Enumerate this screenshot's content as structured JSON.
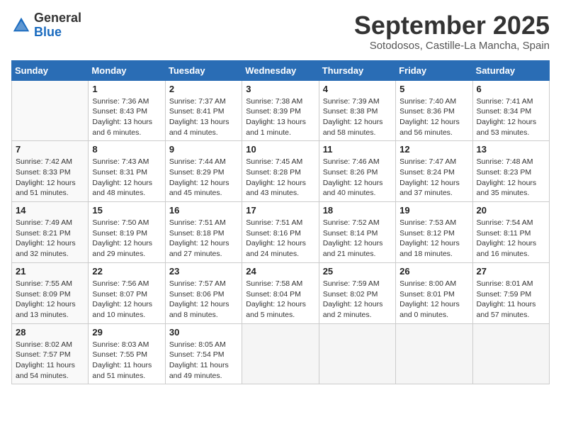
{
  "logo": {
    "general": "General",
    "blue": "Blue"
  },
  "title": "September 2025",
  "subtitle": "Sotodosos, Castille-La Mancha, Spain",
  "days_of_week": [
    "Sunday",
    "Monday",
    "Tuesday",
    "Wednesday",
    "Thursday",
    "Friday",
    "Saturday"
  ],
  "weeks": [
    [
      {
        "day": "",
        "info": ""
      },
      {
        "day": "1",
        "info": "Sunrise: 7:36 AM\nSunset: 8:43 PM\nDaylight: 13 hours\nand 6 minutes."
      },
      {
        "day": "2",
        "info": "Sunrise: 7:37 AM\nSunset: 8:41 PM\nDaylight: 13 hours\nand 4 minutes."
      },
      {
        "day": "3",
        "info": "Sunrise: 7:38 AM\nSunset: 8:39 PM\nDaylight: 13 hours\nand 1 minute."
      },
      {
        "day": "4",
        "info": "Sunrise: 7:39 AM\nSunset: 8:38 PM\nDaylight: 12 hours\nand 58 minutes."
      },
      {
        "day": "5",
        "info": "Sunrise: 7:40 AM\nSunset: 8:36 PM\nDaylight: 12 hours\nand 56 minutes."
      },
      {
        "day": "6",
        "info": "Sunrise: 7:41 AM\nSunset: 8:34 PM\nDaylight: 12 hours\nand 53 minutes."
      }
    ],
    [
      {
        "day": "7",
        "info": "Sunrise: 7:42 AM\nSunset: 8:33 PM\nDaylight: 12 hours\nand 51 minutes."
      },
      {
        "day": "8",
        "info": "Sunrise: 7:43 AM\nSunset: 8:31 PM\nDaylight: 12 hours\nand 48 minutes."
      },
      {
        "day": "9",
        "info": "Sunrise: 7:44 AM\nSunset: 8:29 PM\nDaylight: 12 hours\nand 45 minutes."
      },
      {
        "day": "10",
        "info": "Sunrise: 7:45 AM\nSunset: 8:28 PM\nDaylight: 12 hours\nand 43 minutes."
      },
      {
        "day": "11",
        "info": "Sunrise: 7:46 AM\nSunset: 8:26 PM\nDaylight: 12 hours\nand 40 minutes."
      },
      {
        "day": "12",
        "info": "Sunrise: 7:47 AM\nSunset: 8:24 PM\nDaylight: 12 hours\nand 37 minutes."
      },
      {
        "day": "13",
        "info": "Sunrise: 7:48 AM\nSunset: 8:23 PM\nDaylight: 12 hours\nand 35 minutes."
      }
    ],
    [
      {
        "day": "14",
        "info": "Sunrise: 7:49 AM\nSunset: 8:21 PM\nDaylight: 12 hours\nand 32 minutes."
      },
      {
        "day": "15",
        "info": "Sunrise: 7:50 AM\nSunset: 8:19 PM\nDaylight: 12 hours\nand 29 minutes."
      },
      {
        "day": "16",
        "info": "Sunrise: 7:51 AM\nSunset: 8:18 PM\nDaylight: 12 hours\nand 27 minutes."
      },
      {
        "day": "17",
        "info": "Sunrise: 7:51 AM\nSunset: 8:16 PM\nDaylight: 12 hours\nand 24 minutes."
      },
      {
        "day": "18",
        "info": "Sunrise: 7:52 AM\nSunset: 8:14 PM\nDaylight: 12 hours\nand 21 minutes."
      },
      {
        "day": "19",
        "info": "Sunrise: 7:53 AM\nSunset: 8:12 PM\nDaylight: 12 hours\nand 18 minutes."
      },
      {
        "day": "20",
        "info": "Sunrise: 7:54 AM\nSunset: 8:11 PM\nDaylight: 12 hours\nand 16 minutes."
      }
    ],
    [
      {
        "day": "21",
        "info": "Sunrise: 7:55 AM\nSunset: 8:09 PM\nDaylight: 12 hours\nand 13 minutes."
      },
      {
        "day": "22",
        "info": "Sunrise: 7:56 AM\nSunset: 8:07 PM\nDaylight: 12 hours\nand 10 minutes."
      },
      {
        "day": "23",
        "info": "Sunrise: 7:57 AM\nSunset: 8:06 PM\nDaylight: 12 hours\nand 8 minutes."
      },
      {
        "day": "24",
        "info": "Sunrise: 7:58 AM\nSunset: 8:04 PM\nDaylight: 12 hours\nand 5 minutes."
      },
      {
        "day": "25",
        "info": "Sunrise: 7:59 AM\nSunset: 8:02 PM\nDaylight: 12 hours\nand 2 minutes."
      },
      {
        "day": "26",
        "info": "Sunrise: 8:00 AM\nSunset: 8:01 PM\nDaylight: 12 hours\nand 0 minutes."
      },
      {
        "day": "27",
        "info": "Sunrise: 8:01 AM\nSunset: 7:59 PM\nDaylight: 11 hours\nand 57 minutes."
      }
    ],
    [
      {
        "day": "28",
        "info": "Sunrise: 8:02 AM\nSunset: 7:57 PM\nDaylight: 11 hours\nand 54 minutes."
      },
      {
        "day": "29",
        "info": "Sunrise: 8:03 AM\nSunset: 7:55 PM\nDaylight: 11 hours\nand 51 minutes."
      },
      {
        "day": "30",
        "info": "Sunrise: 8:05 AM\nSunset: 7:54 PM\nDaylight: 11 hours\nand 49 minutes."
      },
      {
        "day": "",
        "info": ""
      },
      {
        "day": "",
        "info": ""
      },
      {
        "day": "",
        "info": ""
      },
      {
        "day": "",
        "info": ""
      }
    ]
  ]
}
